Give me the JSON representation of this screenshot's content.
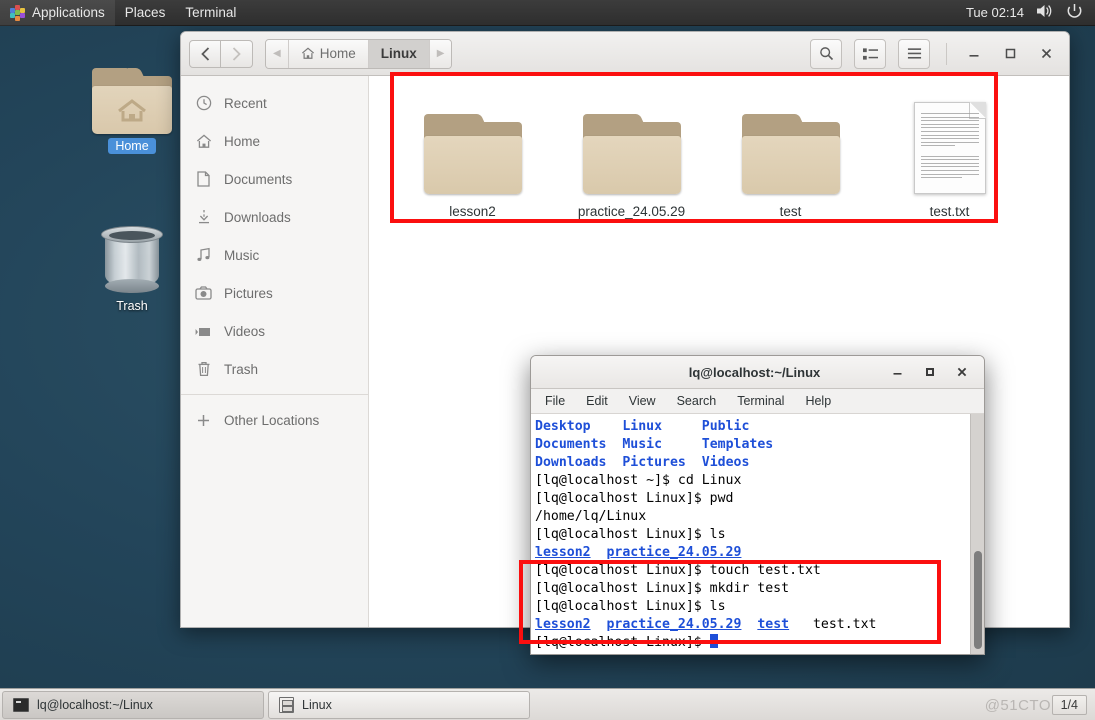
{
  "topbar": {
    "apps_label": "Applications",
    "places_label": "Places",
    "terminal_label": "Terminal",
    "clock": "Tue 02:14",
    "volume_icon": "speaker-icon",
    "power_icon": "power-icon"
  },
  "desktop": {
    "icons": [
      {
        "label": "Home",
        "type": "folder",
        "selected": true
      },
      {
        "label": "Trash",
        "type": "trash",
        "selected": false
      }
    ],
    "background_color": "#234656"
  },
  "file_manager": {
    "window_title": "Linux",
    "nav": {
      "back": "‹",
      "forward": "›"
    },
    "breadcrumbs": [
      {
        "label": "",
        "icon": "chevron-left-icon",
        "active": false
      },
      {
        "label": "Home",
        "icon": "home-icon",
        "active": false
      },
      {
        "label": "Linux",
        "icon": "",
        "active": true
      },
      {
        "label": "",
        "icon": "chevron-right-icon",
        "active": false
      }
    ],
    "toolbar": {
      "search_icon": "search-icon",
      "view_toggle_icon": "list-view-icon",
      "menu_icon": "hamburger-menu-icon",
      "minimize": "–",
      "maximize": "□",
      "close": "✕"
    },
    "sidebar": [
      {
        "label": "Recent",
        "icon": "clock-icon"
      },
      {
        "label": "Home",
        "icon": "home-icon"
      },
      {
        "label": "Documents",
        "icon": "document-icon"
      },
      {
        "label": "Downloads",
        "icon": "download-icon"
      },
      {
        "label": "Music",
        "icon": "music-note-icon"
      },
      {
        "label": "Pictures",
        "icon": "camera-icon"
      },
      {
        "label": "Videos",
        "icon": "video-icon"
      },
      {
        "label": "Trash",
        "icon": "trash-icon"
      }
    ],
    "sidebar_footer": {
      "label": "Other Locations",
      "icon": "plus-icon"
    },
    "files": [
      {
        "name": "lesson2",
        "type": "folder"
      },
      {
        "name": "practice_24.05.29",
        "type": "folder"
      },
      {
        "name": "test",
        "type": "folder"
      },
      {
        "name": "test.txt",
        "type": "document"
      }
    ]
  },
  "terminal": {
    "title": "lq@localhost:~/Linux",
    "window_buttons": {
      "minimize": "–",
      "maximize": "□",
      "close": "✕"
    },
    "menu": [
      "File",
      "Edit",
      "View",
      "Search",
      "Terminal",
      "Help"
    ],
    "lines": [
      [
        {
          "t": "Desktop",
          "c": "b"
        },
        {
          "t": "    ",
          "c": ""
        },
        {
          "t": "Linux",
          "c": "b"
        },
        {
          "t": "     ",
          "c": ""
        },
        {
          "t": "Public",
          "c": "b"
        }
      ],
      [
        {
          "t": "Documents",
          "c": "b"
        },
        {
          "t": "  ",
          "c": ""
        },
        {
          "t": "Music",
          "c": "b"
        },
        {
          "t": "     ",
          "c": ""
        },
        {
          "t": "Templates",
          "c": "b"
        }
      ],
      [
        {
          "t": "Downloads",
          "c": "b"
        },
        {
          "t": "  ",
          "c": ""
        },
        {
          "t": "Pictures",
          "c": "b"
        },
        {
          "t": "  ",
          "c": ""
        },
        {
          "t": "Videos",
          "c": "b"
        }
      ],
      [
        {
          "t": "[lq@localhost ~]$ cd Linux",
          "c": ""
        }
      ],
      [
        {
          "t": "[lq@localhost Linux]$ pwd",
          "c": ""
        }
      ],
      [
        {
          "t": "/home/lq/Linux",
          "c": ""
        }
      ],
      [
        {
          "t": "[lq@localhost Linux]$ ls",
          "c": ""
        }
      ],
      [
        {
          "t": "lesson2",
          "c": "bu"
        },
        {
          "t": "  ",
          "c": ""
        },
        {
          "t": "practice_24.05.29",
          "c": "bu"
        }
      ],
      [
        {
          "t": "[lq@localhost Linux]$ touch test.txt",
          "c": ""
        }
      ],
      [
        {
          "t": "[lq@localhost Linux]$ mkdir test",
          "c": ""
        }
      ],
      [
        {
          "t": "[lq@localhost Linux]$ ls",
          "c": ""
        }
      ],
      [
        {
          "t": "lesson2",
          "c": "bu"
        },
        {
          "t": "  ",
          "c": ""
        },
        {
          "t": "practice_24.05.29",
          "c": "bu"
        },
        {
          "t": "  ",
          "c": ""
        },
        {
          "t": "test",
          "c": "bu"
        },
        {
          "t": "   ",
          "c": ""
        },
        {
          "t": "test.txt",
          "c": ""
        }
      ],
      [
        {
          "t": "[lq@localhost Linux]$ ",
          "c": ""
        }
      ]
    ]
  },
  "taskbar": {
    "tasks": [
      {
        "label": "lq@localhost:~/Linux",
        "icon": "terminal-icon",
        "active": true
      },
      {
        "label": "Linux",
        "icon": "file-manager-icon",
        "active": false
      }
    ],
    "workspace": "1/4",
    "watermark": "@51CTO"
  },
  "annotations": {
    "highlight_color": "#fb0f0f",
    "boxes": [
      {
        "target": "file-grid"
      },
      {
        "target": "terminal-commands"
      }
    ]
  }
}
